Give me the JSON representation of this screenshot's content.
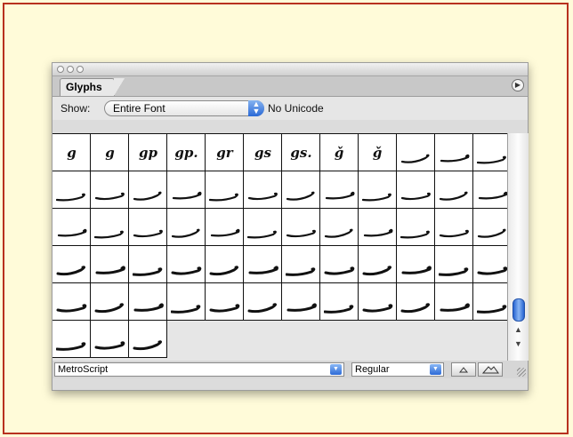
{
  "panel": {
    "tab_label": "Glyphs",
    "show_label": "Show:",
    "show_value": "Entire Font",
    "unicode_status": "No Unicode"
  },
  "glyph_rows": [
    [
      {
        "label": "g",
        "icon": "script-g-glyph"
      },
      {
        "label": "g",
        "icon": "script-g-swash-glyph"
      },
      {
        "label": "gp",
        "icon": "script-gp-ligature-glyph"
      },
      {
        "label": "gp.",
        "icon": "script-gp-dot-glyph"
      },
      {
        "label": "gr",
        "icon": "script-gr-ligature-glyph"
      },
      {
        "label": "gs",
        "icon": "script-gs-ligature-glyph"
      },
      {
        "label": "gs.",
        "icon": "script-gs-dot-glyph"
      },
      {
        "label": "ǧ",
        "icon": "script-g-caron-glyph"
      },
      {
        "label": "ǧ",
        "icon": "script-g-caron-swash-glyph"
      },
      {
        "label": "",
        "icon": "swash-ending-glyph"
      },
      {
        "label": "",
        "icon": "swash-ending-glyph"
      },
      {
        "label": "",
        "icon": "swash-ending-glyph"
      }
    ],
    [
      {
        "label": "",
        "icon": "swash-ending-glyph"
      },
      {
        "label": "",
        "icon": "swash-ending-glyph"
      },
      {
        "label": "",
        "icon": "swash-ending-glyph"
      },
      {
        "label": "",
        "icon": "swash-ending-glyph"
      },
      {
        "label": "",
        "icon": "swash-ending-glyph"
      },
      {
        "label": "",
        "icon": "swash-ending-glyph"
      },
      {
        "label": "",
        "icon": "swash-ending-glyph"
      },
      {
        "label": "",
        "icon": "swash-ending-glyph"
      },
      {
        "label": "",
        "icon": "swash-ending-glyph"
      },
      {
        "label": "",
        "icon": "swash-ending-glyph"
      },
      {
        "label": "",
        "icon": "swash-ending-glyph"
      },
      {
        "label": "",
        "icon": "swash-ending-glyph"
      }
    ],
    [
      {
        "label": "",
        "icon": "swash-ending-glyph"
      },
      {
        "label": "",
        "icon": "swash-ending-glyph"
      },
      {
        "label": "",
        "icon": "swash-ending-glyph"
      },
      {
        "label": "",
        "icon": "swash-ending-glyph"
      },
      {
        "label": "",
        "icon": "swash-ending-glyph"
      },
      {
        "label": "",
        "icon": "swash-ending-glyph"
      },
      {
        "label": "",
        "icon": "swash-ending-glyph"
      },
      {
        "label": "",
        "icon": "swash-ending-glyph"
      },
      {
        "label": "",
        "icon": "swash-ending-glyph"
      },
      {
        "label": "",
        "icon": "swash-ending-glyph"
      },
      {
        "label": "",
        "icon": "swash-ending-glyph"
      },
      {
        "label": "",
        "icon": "swash-ending-glyph"
      }
    ],
    [
      {
        "label": "",
        "icon": "swash-ending-glyph"
      },
      {
        "label": "",
        "icon": "swash-ending-glyph"
      },
      {
        "label": "",
        "icon": "swash-ending-glyph"
      },
      {
        "label": "",
        "icon": "swash-ending-glyph"
      },
      {
        "label": "",
        "icon": "swash-ending-glyph"
      },
      {
        "label": "",
        "icon": "swash-ending-glyph"
      },
      {
        "label": "",
        "icon": "swash-ending-glyph"
      },
      {
        "label": "",
        "icon": "swash-ending-glyph"
      },
      {
        "label": "",
        "icon": "swash-ending-glyph"
      },
      {
        "label": "",
        "icon": "swash-ending-glyph"
      },
      {
        "label": "",
        "icon": "swash-ending-glyph"
      },
      {
        "label": "",
        "icon": "swash-ending-glyph"
      }
    ],
    [
      {
        "label": "",
        "icon": "swash-ending-glyph"
      },
      {
        "label": "",
        "icon": "swash-ending-glyph"
      },
      {
        "label": "",
        "icon": "swash-ending-glyph"
      },
      {
        "label": "",
        "icon": "swash-ending-glyph"
      },
      {
        "label": "",
        "icon": "swash-ending-glyph"
      },
      {
        "label": "",
        "icon": "swash-ending-glyph"
      },
      {
        "label": "",
        "icon": "swash-ending-glyph"
      },
      {
        "label": "",
        "icon": "swash-ending-glyph"
      },
      {
        "label": "",
        "icon": "swash-ending-glyph"
      },
      {
        "label": "",
        "icon": "swash-ending-glyph"
      },
      {
        "label": "",
        "icon": "swash-ending-glyph"
      },
      {
        "label": "",
        "icon": "swash-ending-glyph"
      }
    ],
    [
      {
        "label": "",
        "icon": "swash-ending-glyph"
      },
      {
        "label": "",
        "icon": "swash-ending-glyph"
      },
      {
        "label": "",
        "icon": "swash-ending-glyph"
      }
    ]
  ],
  "footer": {
    "font_name": "MetroScript",
    "font_style": "Regular"
  },
  "colors": {
    "page_background": "#fffbd9",
    "frame_border": "#b8301f",
    "accent_blue": "#2a69d6"
  }
}
